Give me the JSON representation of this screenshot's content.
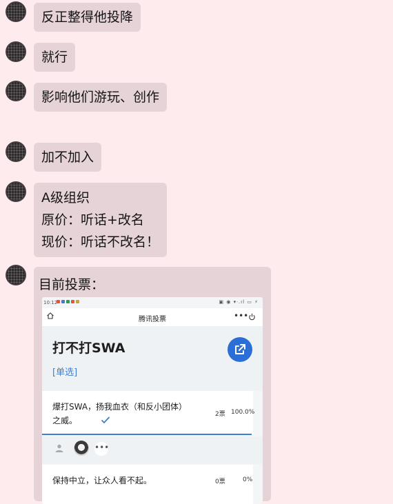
{
  "messages": [
    {
      "lines": [
        "反正整得他投降"
      ]
    },
    {
      "lines": [
        "就行"
      ]
    },
    {
      "lines": [
        "影响他们游玩、创作"
      ]
    },
    {
      "lines": [
        "加不加入"
      ]
    },
    {
      "lines": [
        "A级组织",
        "原价：听话+改名",
        "现价：听话不改名！"
      ]
    }
  ],
  "image_message": {
    "caption": "目前投票：",
    "screenshot": {
      "status_time": "10:12",
      "status_right": "▣ ◉ ▾ᐧ.ıl ▭ ⚡",
      "header_title": "腾讯投票",
      "more_icon": "more-icon",
      "poll": {
        "title": "打不打SWA",
        "type": "[单选]",
        "options": [
          {
            "text": "爆打SWA，扬我血衣（和反小团体）之威。",
            "votes": "2票",
            "percent": "100.0%",
            "fraction": 1.0,
            "selected": true
          },
          {
            "text": "保持中立，让众人看不起。",
            "votes": "0票",
            "percent": "0%",
            "fraction": 0.0,
            "selected": false
          }
        ],
        "voters_more": "•••"
      }
    }
  },
  "colors": {
    "background": "#fdebee",
    "bubble": "#e6d3d8",
    "accent": "#2b6fd6",
    "link": "#3d7ed0"
  }
}
